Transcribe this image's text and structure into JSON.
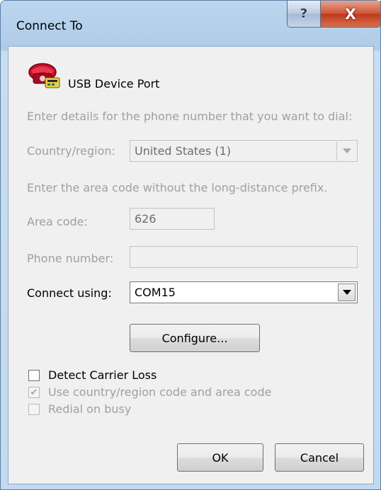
{
  "window": {
    "title": "Connect To",
    "help_label": "?",
    "close_label": "X"
  },
  "header": {
    "connection_name": "USB Device Port",
    "icon": "phone-modem-icon"
  },
  "form": {
    "phone_instruction": "Enter details for the phone number that you want to dial:",
    "country_label": "Country/region:",
    "country_value": "United States (1)",
    "area_instruction": "Enter the area code without the long-distance prefix.",
    "area_code_label": "Area code:",
    "area_code_value": "626",
    "phone_number_label": "Phone number:",
    "phone_number_value": "",
    "connect_using_label": "Connect using:",
    "connect_using_value": "COM15",
    "configure_label": "Configure..."
  },
  "options": {
    "detect_carrier_loss": {
      "label": "Detect Carrier Loss",
      "checked": false,
      "enabled": true
    },
    "use_country_code": {
      "label": "Use country/region code and area code",
      "checked": true,
      "enabled": false
    },
    "redial_on_busy": {
      "label": "Redial on busy",
      "checked": false,
      "enabled": false
    }
  },
  "buttons": {
    "ok_label": "OK",
    "cancel_label": "Cancel"
  }
}
